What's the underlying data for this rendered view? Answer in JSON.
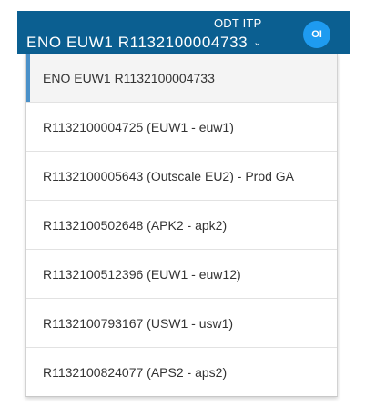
{
  "header": {
    "org_label": "ODT ITP",
    "tenant_label": "ENO EUW1 R1132100004733",
    "chevron_glyph": "⌄",
    "avatar_initials": "OI",
    "bg_color": "#0b5f91",
    "avatar_color": "#1e9bf0"
  },
  "dropdown": {
    "items": [
      {
        "label": "ENO EUW1 R1132100004733",
        "selected": true
      },
      {
        "label": "R1132100004725 (EUW1 - euw1)"
      },
      {
        "label": "R1132100005643 (Outscale EU2) - Prod GA"
      },
      {
        "label": "R1132100502648 (APK2 - apk2)"
      },
      {
        "label": "R1132100512396 (EUW1 - euw12)"
      },
      {
        "label": "R1132100793167 (USW1 - usw1)"
      },
      {
        "label": "R1132100824077 (APS2 - aps2)"
      }
    ],
    "accent_color": "#4a90c8"
  }
}
